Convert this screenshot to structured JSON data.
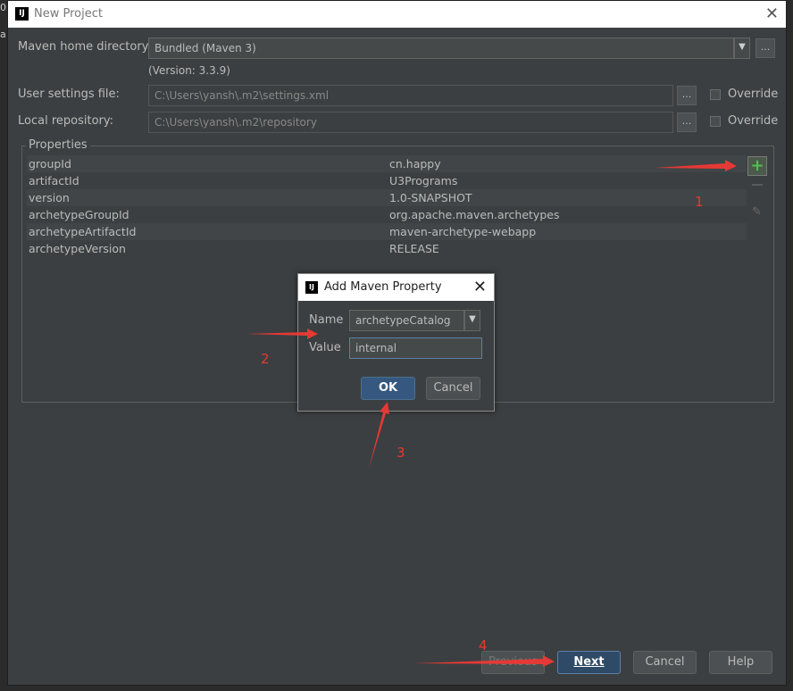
{
  "window": {
    "title": "New Project",
    "close_glyph": "✕",
    "app_icon_text": "IJ"
  },
  "form": {
    "maven_home_label": "Maven home directory:",
    "maven_home_value": "Bundled (Maven 3)",
    "maven_home_arrow": "▼",
    "version_text": "(Version: 3.3.9)",
    "user_settings_label": "User settings file:",
    "user_settings_value": "C:\\Users\\yansh\\.m2\\settings.xml",
    "local_repo_label": "Local repository:",
    "local_repo_value": "C:\\Users\\yansh\\.m2\\repository",
    "browse_label": "...",
    "override_label": "Override"
  },
  "properties": {
    "title": "Properties",
    "rows": [
      {
        "name": "groupId",
        "value": "cn.happy"
      },
      {
        "name": "artifactId",
        "value": "U3Programs"
      },
      {
        "name": "version",
        "value": "1.0-SNAPSHOT"
      },
      {
        "name": "archetypeGroupId",
        "value": "org.apache.maven.archetypes"
      },
      {
        "name": "archetypeArtifactId",
        "value": "maven-archetype-webapp"
      },
      {
        "name": "archetypeVersion",
        "value": "RELEASE"
      }
    ],
    "add_glyph": "+",
    "edit_glyph": "✎"
  },
  "dialog": {
    "title": "Add Maven Property",
    "icon_text": "IJ",
    "close_glyph": "✕",
    "name_label": "Name",
    "name_value": "archetypeCatalog",
    "name_arrow": "▼",
    "value_label": "Value",
    "value_value": "internal",
    "ok_label": "OK",
    "cancel_label": "Cancel"
  },
  "footer": {
    "previous_label": "Previous",
    "next_label": "Next",
    "cancel_label": "Cancel",
    "help_label": "Help"
  },
  "annotations": {
    "one": "1",
    "two": "2",
    "three": "3",
    "four": "4"
  },
  "colors": {
    "background": "#3c3f41",
    "accent": "#365880",
    "annotation": "#e53935",
    "add": "#4ec14e"
  }
}
